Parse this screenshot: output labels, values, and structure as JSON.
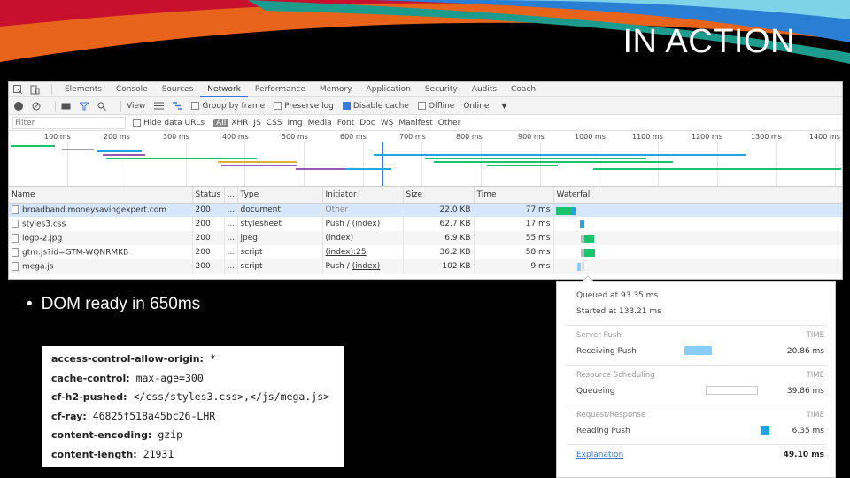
{
  "slide": {
    "title": "IN ACTION",
    "bullet": "DOM ready in 650ms"
  },
  "devtools": {
    "tabs": [
      "Elements",
      "Console",
      "Sources",
      "Network",
      "Performance",
      "Memory",
      "Application",
      "Security",
      "Audits",
      "Coach"
    ],
    "active_tab": "Network",
    "toolbar": {
      "view": "View",
      "group_by_frame": "Group by frame",
      "preserve_log": "Preserve log",
      "disable_cache": "Disable cache",
      "offline": "Offline",
      "online": "Online"
    },
    "filter": {
      "placeholder": "Filter",
      "hide_data_urls": "Hide data URLs",
      "types": [
        "All",
        "XHR",
        "JS",
        "CSS",
        "Img",
        "Media",
        "Font",
        "Doc",
        "WS",
        "Manifest",
        "Other"
      ]
    },
    "timeline_ticks": [
      "100 ms",
      "200 ms",
      "300 ms",
      "400 ms",
      "500 ms",
      "600 ms",
      "700 ms",
      "800 ms",
      "900 ms",
      "1000 ms",
      "1100 ms",
      "1200 ms",
      "1300 ms",
      "1400 ms"
    ],
    "columns": {
      "name": "Name",
      "status": "Status",
      "more": "...",
      "type": "Type",
      "initiator": "Initiator",
      "size": "Size",
      "time": "Time",
      "waterfall": "Waterfall"
    },
    "rows": [
      {
        "name": "broadband.moneysavingexpert.com",
        "status": "200",
        "more": "...",
        "type": "document",
        "initiator": "Other",
        "size": "22.0 KB",
        "time": "77 ms"
      },
      {
        "name": "styles3.css",
        "status": "200",
        "more": "...",
        "type": "stylesheet",
        "initiator_prefix": "Push / ",
        "initiator_link": "(index)",
        "size": "62.7 KB",
        "time": "17 ms"
      },
      {
        "name": "logo-2.jpg",
        "status": "200",
        "more": "...",
        "type": "jpeg",
        "initiator": "(index)",
        "size": "6.9 KB",
        "time": "55 ms"
      },
      {
        "name": "gtm.js?id=GTM-WQNRMKB",
        "status": "200",
        "more": "...",
        "type": "script",
        "initiator_link": "(index):25",
        "size": "36.2 KB",
        "time": "58 ms"
      },
      {
        "name": "mega.js",
        "status": "200",
        "more": "...",
        "type": "script",
        "initiator_prefix": "Push / ",
        "initiator_link": "(index)",
        "size": "102 KB",
        "time": "9 ms"
      }
    ]
  },
  "headers": [
    {
      "key": "access-control-allow-origin:",
      "value": "*"
    },
    {
      "key": "cache-control:",
      "value": "max-age=300"
    },
    {
      "key": "cf-h2-pushed:",
      "value": "</css/styles3.css>,</js/mega.js>"
    },
    {
      "key": "cf-ray:",
      "value": "46825f518a45bc26-LHR"
    },
    {
      "key": "content-encoding:",
      "value": "gzip"
    },
    {
      "key": "content-length:",
      "value": "21931"
    }
  ],
  "timing_popup": {
    "queued_at": "Queued at 93.35 ms",
    "started_at": "Started at 133.21 ms",
    "time_header": "TIME",
    "sections": [
      {
        "title": "Server Push",
        "label": "Receiving Push",
        "value": "20.86 ms",
        "color": "#87cdf5"
      },
      {
        "title": "Resource Scheduling",
        "label": "Queueing",
        "value": "39.86 ms",
        "color": "#ffffff"
      },
      {
        "title": "Request/Response",
        "label": "Reading Push",
        "value": "6.35 ms",
        "color": "#21a3e4"
      }
    ],
    "explanation": "Explanation",
    "total": "49.10 ms"
  },
  "colors": {
    "accent": "#3879d9",
    "green": "#19c36d",
    "blue": "#21a3e4",
    "push": "#87cdf5"
  }
}
